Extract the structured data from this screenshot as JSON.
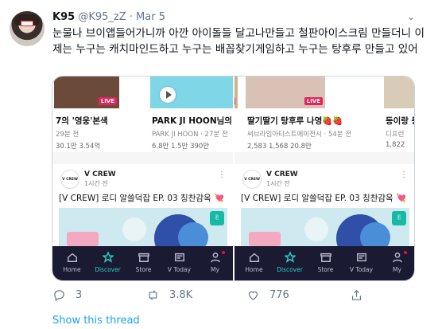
{
  "tweet": {
    "author_name": "K95",
    "handle": "@K95_zZ",
    "separator": "·",
    "date": "Mar 5",
    "text": "눈물나 브이앱들어가니까 아깐 아이돌들 달고나만들고 철판아이스크림 만들더니 이제는 누구는 캐치마인드하고 누구는 배꼽찾기게임하고 누구는 탕후루 만들고 있어"
  },
  "screenshots": [
    {
      "cards": [
        {
          "title": "7의 '영웅'본색",
          "meta": "29분 전",
          "stats": "30.1만   3.54억",
          "live": true,
          "thumb_color": "#6b4a3a",
          "play": false
        },
        {
          "title": "PARK JI HOON님의 라이",
          "meta": "PARK JI HOON · 27분 전",
          "stats": "6.8만   1.5만   390만",
          "live": false,
          "thumb_color": "#7fd6e6",
          "play": true
        },
        {
          "title": "",
          "meta": "",
          "stats": "",
          "live": false,
          "thumb_color": "#eeeeee",
          "play": false
        }
      ],
      "post": {
        "channel": "V CREW",
        "channel_logo": "V CREW",
        "time": "1시간 전",
        "title": "[V CREW] 로디 알쓸덕잡 EP. 03 칭찬감옥",
        "heart": "💘"
      }
    },
    {
      "cards": [
        {
          "title": "",
          "meta": "",
          "stats": "",
          "live": true,
          "thumb_color": "#c9b48e",
          "play": false
        },
        {
          "title": "딸기딸기 탕후루 나영🍓🍓",
          "meta": "써브라임아티스트에이전시 · 54분 전",
          "stats": "2,583   1,568   20.8만",
          "live": true,
          "thumb_color": "#d9c2b5",
          "play": false
        },
        {
          "title": "등이랑 등",
          "meta": "디프런",
          "stats": "1,822",
          "live": false,
          "thumb_color": "#d8ccb8",
          "play": false
        }
      ],
      "post": {
        "channel": "V CREW",
        "channel_logo": "V CREW",
        "time": "1시간 전",
        "title": "[V CREW] 로디 알쓸덕잡 EP. 03 칭찬감옥",
        "heart": "💘"
      }
    }
  ],
  "app_nav": [
    {
      "label": "Home",
      "icon": "home-icon"
    },
    {
      "label": "Discover",
      "icon": "discover-star-icon",
      "active": true
    },
    {
      "label": "Store",
      "icon": "store-icon"
    },
    {
      "label": "V Today",
      "icon": "vtoday-icon"
    },
    {
      "label": "My",
      "icon": "profile-icon",
      "dot": true
    }
  ],
  "live_label": "LIVE",
  "actions": {
    "replies": "3",
    "retweets": "3.8K",
    "likes": "776"
  },
  "show_thread": "Show this thread",
  "colors": {
    "link": "#1da1f2",
    "muted": "#657786",
    "live": "#e0245e",
    "nav_bg": "#1b1a33",
    "nav_active": "#25d3c0"
  }
}
